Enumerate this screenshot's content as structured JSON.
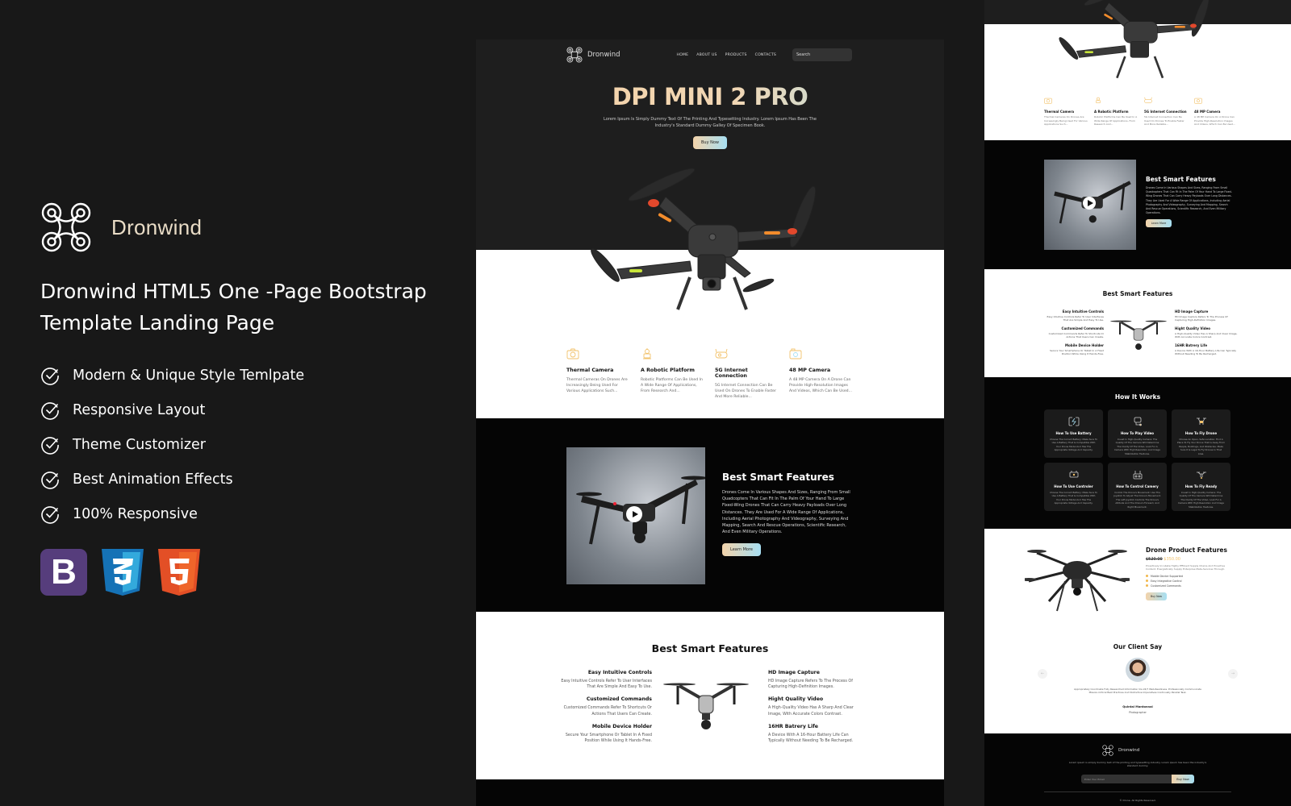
{
  "promo": {
    "brand": "Dronwind",
    "title": "Dronwind HTML5 One -Page Bootstrap Template Landing Page",
    "features": [
      "Modern & Unique Style Temlpate",
      "Responsive Layout",
      "Theme Customizer",
      "Best Animation Effects",
      "100% Responsive"
    ],
    "tech_badges": [
      "bootstrap-icon",
      "css3-icon",
      "html5-icon"
    ],
    "bootstrap_letter": "B"
  },
  "preview": {
    "nav": {
      "brand": "Dronwind",
      "menu": [
        "HOME",
        "ABOUT US",
        "PRODUCTS",
        "CONTACTS"
      ],
      "search_placeholder": "Search"
    },
    "hero": {
      "title": "DPI MINI 2 PRO",
      "subtitle": "Lorem Ipsum Is Simply Dummy Text Of The Printing And Typesetting Industry. Lorem Ipsum Has Been The Industry's Standard Dummy Galley Of Specimen Book.",
      "cta": "Buy Now"
    },
    "features": [
      {
        "icon": "camera-icon",
        "title": "Thermal Camera",
        "desc": "Thermal Cameras On Drones Are Increasingly Being Used For Various Applications Such..."
      },
      {
        "icon": "robot-icon",
        "title": "A Robotic Platform",
        "desc": "Robotic Platforms Can Be Used In A Wide Range Of Applications, From Research And..."
      },
      {
        "icon": "router-icon",
        "title": "5G Internet Connection",
        "desc": "5G Internet Connection Can Be Used On Drones To Enable Faster And More Reliable..."
      },
      {
        "icon": "photo-camera-icon",
        "title": "48 MP Camera",
        "desc": "A 48 MP Camera On A Drone Can Provide High-Resolution Images And Videos, Which Can Be Used..."
      }
    ],
    "smart": {
      "title": "Best Smart Features",
      "body": "Drones Come In Various Shapes And Sizes, Ranging From Small Quadcopters That Can Fit In The Palm Of Your Hand To Large Fixed-Wing Drones That Can Carry Heavy Payloads Over Long Distances. They Are Used For A Wide Range Of Applications, Including Aerial Photography And Videography, Surveying And Mapping, Search And Rescue Operations, Scientific Research, And Even Military Operations.",
      "cta": "Learn More"
    },
    "best": {
      "title": "Best Smart Features",
      "left": [
        {
          "title": "Easy Intuitive Controls",
          "desc": "Easy Intuitive Controls Refer To User Interfaces That Are Simple And Easy To Use."
        },
        {
          "title": "Customized Commands",
          "desc": "Customized Commands Refer To Shortcuts Or Actions That Users Can Create."
        },
        {
          "title": "Mobile Device Holder",
          "desc": "Secure Your Smartphone Or Tablet In A Fixed Position While Using It Hands-Free."
        }
      ],
      "right": [
        {
          "title": "HD Image Capture",
          "desc": "HD Image Capture Refers To The Process Of Capturing High-Definition Images."
        },
        {
          "title": "Hight Quality Video",
          "desc": "A High-Quality Video Has A Sharp And Clear Image, With Accurate Colors Contrast."
        },
        {
          "title": "16HR Batrery Life",
          "desc": "A Device With A 16-Hour Battery Life Can Typically Without Needing To Be Recharged."
        }
      ]
    },
    "how": {
      "title": "How It Works",
      "cards": [
        {
          "icon": "battery-icon",
          "title": "How To Use Battery",
          "desc": "Choose The Correct Battery: Make Sure To Use A Battery That Is Compatible With Your Drone Model And Has The Appropriate Voltage And Capacity."
        },
        {
          "icon": "video-icon",
          "title": "How To Play Video",
          "desc": "Invest In High-Quality Camera: The Quality Of The Camera Will Determine The Clarity Of The Video. Look For A Camera With High Resolution And Image Stabilization Features."
        },
        {
          "icon": "drone-icon",
          "title": "How To Fly Drone",
          "desc": "Choose An Open, Safe Location: Find A Place To Fly Your Drone That Is Away From People, Buildings, And Obstacles. Make Sure It Is Legal To Fly Drones In That Area."
        },
        {
          "icon": "controller-icon",
          "title": "How To Use Controler",
          "desc": "Choose The Correct Battery: Make Sure To Use A Battery That Is Compatible With Your Drone Model And Has The Appropriate Voltage And Capacity."
        },
        {
          "icon": "remote-icon",
          "title": "How To Control Camery",
          "desc": "Control The Drone's Movement: Use The Joystick To Adjust The Drone's Movement. The Left Joystick Controls The Drone's Altitude And The Drone's Forward, And Right Movement."
        },
        {
          "icon": "drone-ready-icon",
          "title": "How To Fly Ready",
          "desc": "Invest In High-Quality Camera: The Quality Of The Camera Will Determine The Clarity Of The Video. Look For A Camera With High Resolution And Image Stabilization Features."
        }
      ]
    },
    "product": {
      "title": "Drone Product Features",
      "old_price": "$520.00",
      "new_price": "$350.00",
      "desc": "Proactively Incubate Highly Efficient Supply Chains And Proactive Content. Energistically Supply Enterprise Meta-Services Through.",
      "bullets": [
        "Mobile Device Supported",
        "Easy Integrative Control",
        "Customized Commands"
      ],
      "cta": "Buy Now"
    },
    "client": {
      "title": "Our Client Say",
      "quote": "Appropriately Coordinate Fully Researched Information Via 24/7 Web-Readiness. Professionally Communicate Mission-Critical Best Practices And Distinctive Imperatives Continually Parallel Task.",
      "name": "Quintal Mantonnal",
      "role": "Photographer",
      "prev": "←",
      "next": "→"
    },
    "footer": {
      "brand": "Dronwind",
      "desc": "Lorem ipsum is simply dummy text of the printing and typesetting industry. Lorem ipsum has been the industry's standard dummy.",
      "email_placeholder": "Enter Your Email",
      "cta": "Buy Now",
      "copyright": "© Drone. All Rights Reserved."
    }
  },
  "colors": {
    "page_bg": "#181818",
    "hero_bg": "#1e1e1e",
    "section_dark": "#050505",
    "accent_from": "#f3d3aa",
    "accent_to": "#a7dff2",
    "brand_text": "#e9dcc6",
    "price_new": "#f2c26b",
    "bootstrap": "#563d7c",
    "css3": "#1572b6",
    "html5": "#e34f26"
  }
}
